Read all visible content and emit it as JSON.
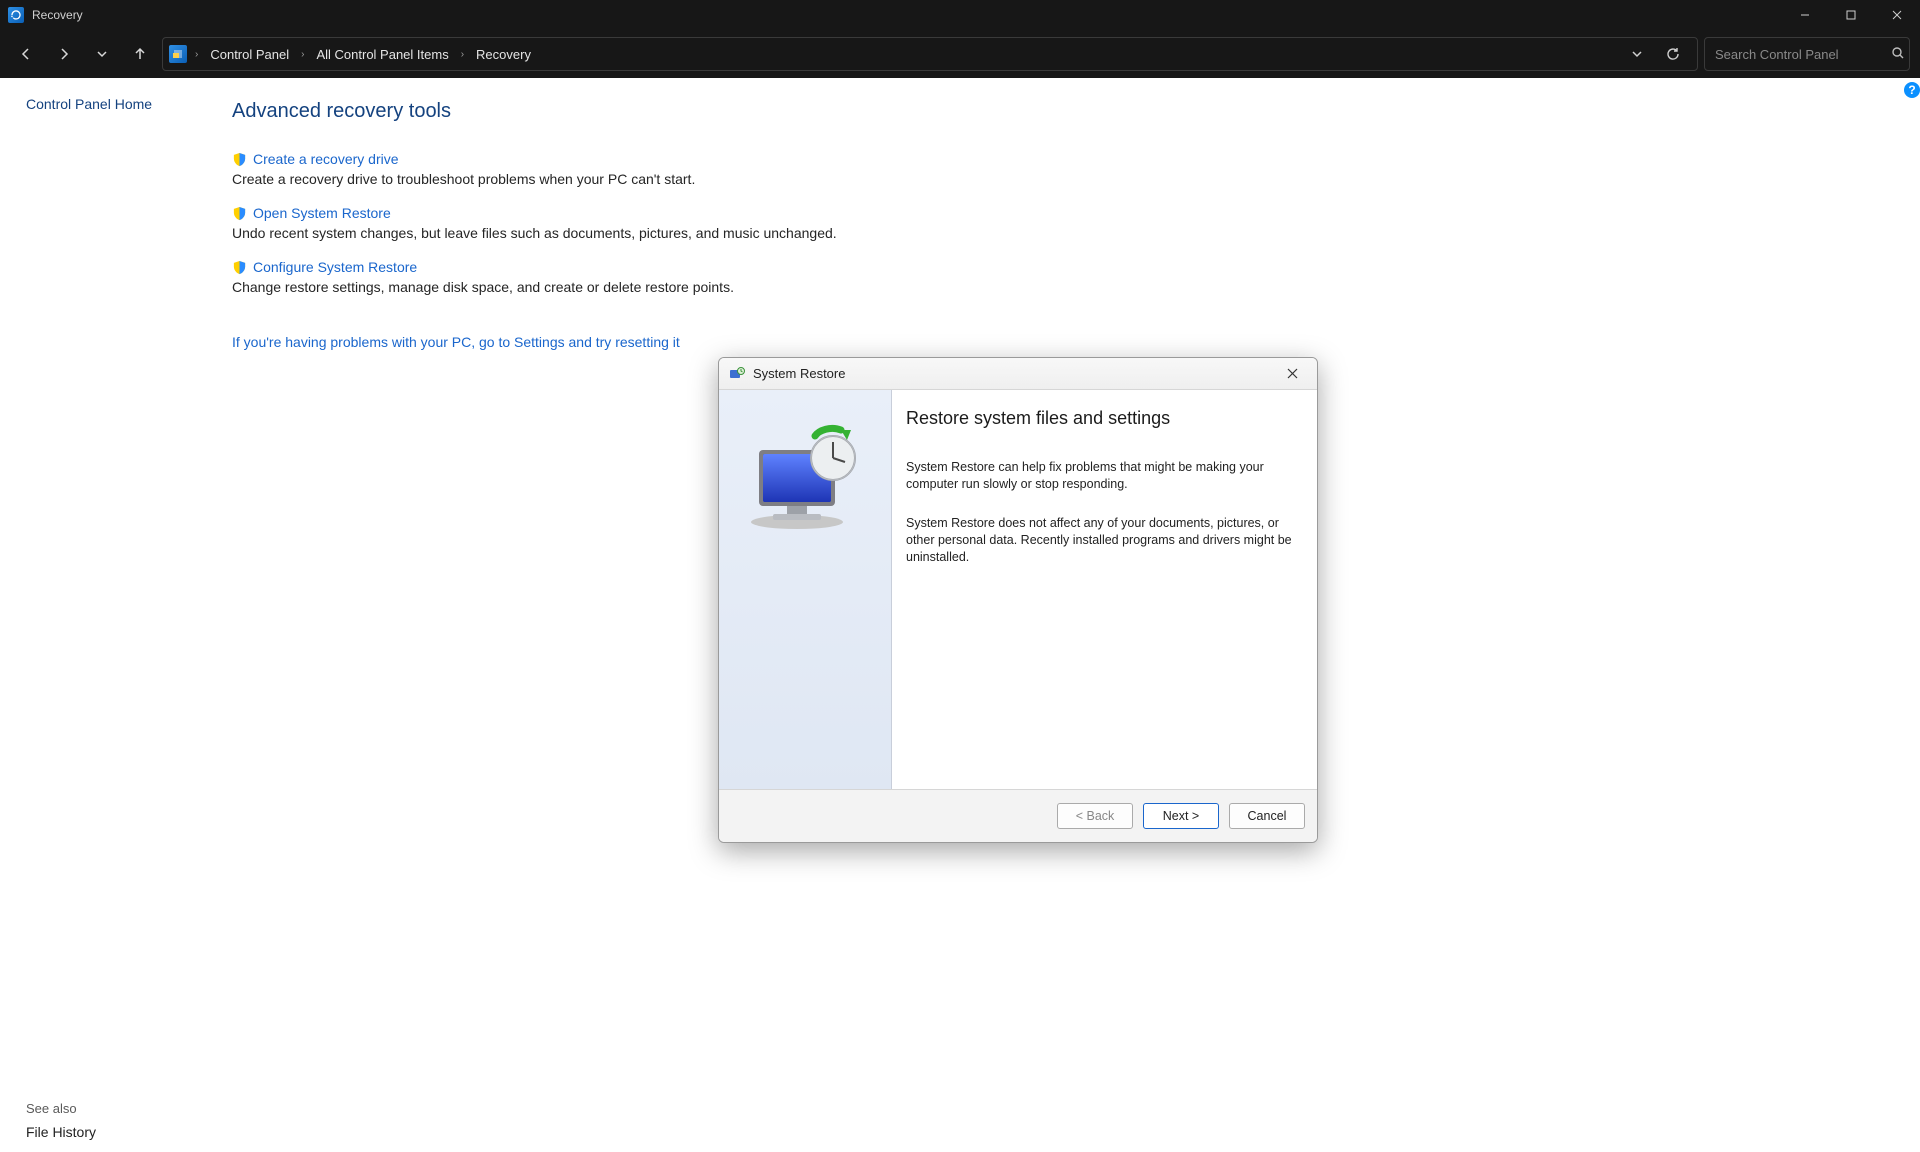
{
  "window": {
    "title": "Recovery"
  },
  "breadcrumb": {
    "parts": [
      "Control Panel",
      "All Control Panel Items",
      "Recovery"
    ]
  },
  "search": {
    "placeholder": "Search Control Panel"
  },
  "leftnav": {
    "home": "Control Panel Home",
    "see_also_label": "See also",
    "file_history": "File History"
  },
  "main": {
    "heading": "Advanced recovery tools",
    "tools": [
      {
        "link": "Create a recovery drive",
        "desc": "Create a recovery drive to troubleshoot problems when your PC can't start."
      },
      {
        "link": "Open System Restore",
        "desc": "Undo recent system changes, but leave files such as documents, pictures, and music unchanged."
      },
      {
        "link": "Configure System Restore",
        "desc": "Change restore settings, manage disk space, and create or delete restore points."
      }
    ],
    "reset_link": "If you're having problems with your PC, go to Settings and try resetting it"
  },
  "dialog": {
    "title": "System Restore",
    "heading": "Restore system files and settings",
    "p1": "System Restore can help fix problems that might be making your computer run slowly or stop responding.",
    "p2": "System Restore does not affect any of your documents, pictures, or other personal data. Recently installed programs and drivers might be uninstalled.",
    "back": "< Back",
    "next": "Next >",
    "cancel": "Cancel"
  },
  "help": {
    "label": "?"
  }
}
